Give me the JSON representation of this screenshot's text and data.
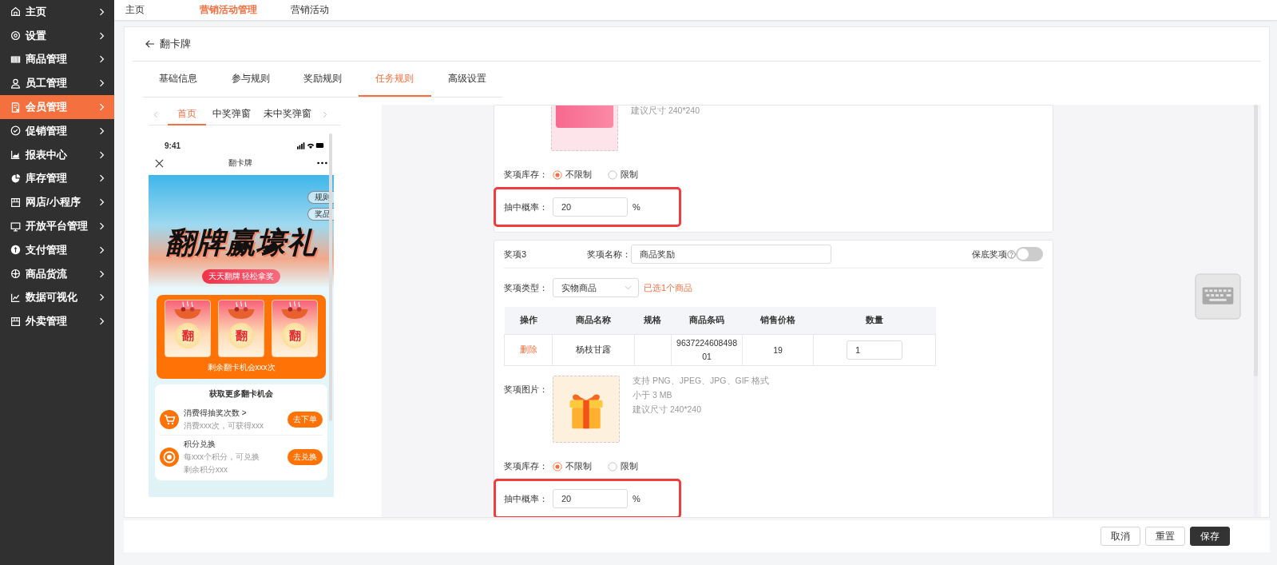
{
  "sidebar": {
    "items": [
      {
        "label": "主页",
        "selected": false
      },
      {
        "label": "设置",
        "selected": false
      },
      {
        "label": "商品管理",
        "selected": false
      },
      {
        "label": "员工管理",
        "selected": false
      },
      {
        "label": "会员管理",
        "selected": true
      },
      {
        "label": "促销管理",
        "selected": false
      },
      {
        "label": "报表中心",
        "selected": false
      },
      {
        "label": "库存管理",
        "selected": false
      },
      {
        "label": "网店/小程序",
        "selected": false
      },
      {
        "label": "开放平台管理",
        "selected": false
      },
      {
        "label": "支付管理",
        "selected": false
      },
      {
        "label": "商品货流",
        "selected": false
      },
      {
        "label": "数据可视化",
        "selected": false
      },
      {
        "label": "外卖管理",
        "selected": false
      }
    ]
  },
  "breadcrumb": [
    {
      "label": "主页",
      "selected": false
    },
    {
      "label": "营销活动管理",
      "selected": true
    },
    {
      "label": "营销活动",
      "selected": false
    }
  ],
  "page": {
    "title": "翻卡牌"
  },
  "tabs": [
    {
      "label": "基础信息",
      "selected": false
    },
    {
      "label": "参与规则",
      "selected": false
    },
    {
      "label": "奖励规则",
      "selected": false
    },
    {
      "label": "任务规则",
      "selected": true
    },
    {
      "label": "高级设置",
      "selected": false
    }
  ],
  "preview": {
    "tabs": [
      {
        "label": "首页",
        "selected": true
      },
      {
        "label": "中奖弹窗",
        "selected": false
      },
      {
        "label": "未中奖弹窗",
        "selected": false
      }
    ],
    "phone": {
      "time": "9:41",
      "title": "翻卡牌",
      "side_buttons": [
        "规则",
        "奖品"
      ],
      "banner_title": "翻牌赢壕礼",
      "banner_tag": "天天翻牌 轻松拿奖",
      "cards": [
        "翻",
        "翻",
        "翻"
      ],
      "remaining": "剩余翻卡机会xxx次",
      "tasks_title": "获取更多翻卡机会",
      "tasks": [
        {
          "title": "消费得抽奖次数 >",
          "lines": [
            "消费xxx次，可获得xxx"
          ],
          "button": "去下单"
        },
        {
          "title": "积分兑换",
          "lines": [
            "每xxx个积分，可兑换",
            "剩余积分xxx"
          ],
          "button": "去兑换"
        }
      ]
    }
  },
  "prizes": [
    {
      "image": {
        "kind": "coupon"
      },
      "image_hints": [
        "建议尺寸 240*240"
      ],
      "stock_label": "奖项库存：",
      "stock_options": [
        {
          "label": "不限制",
          "selected": true
        },
        {
          "label": "限制",
          "selected": false
        }
      ],
      "rate_label": "抽中概率：",
      "rate_value": "20",
      "rate_unit": "%",
      "highlighted": true
    },
    {
      "index_label": "奖项3",
      "name_label": "奖项名称：",
      "name_value": "商品奖励",
      "guarantee_label": "保底奖项",
      "guarantee_on": false,
      "type_label": "奖项类型：",
      "type_value": "实物商品",
      "selected_note": "已选1个商品",
      "table": {
        "columns": [
          {
            "label": "操作",
            "kind": "link"
          },
          {
            "label": "商品名称",
            "kind": "text"
          },
          {
            "label": "规格",
            "kind": "text"
          },
          {
            "label": "商品条码",
            "kind": "wrap"
          },
          {
            "label": "销售价格",
            "kind": "text"
          },
          {
            "label": "数量",
            "kind": "input"
          }
        ],
        "rows": [
          {
            "cells": [
              "删除",
              "杨枝甘露",
              null,
              "963722460849801",
              "19",
              "1"
            ]
          }
        ]
      },
      "image_label": "奖项图片：",
      "image": {
        "kind": "gift"
      },
      "image_hints": [
        "支持 PNG、JPEG、JPG、GIF 格式",
        "小于 3 MB",
        "建议尺寸 240*240"
      ],
      "stock_label": "奖项库存：",
      "stock_options": [
        {
          "label": "不限制",
          "selected": true
        },
        {
          "label": "限制",
          "selected": false
        }
      ],
      "rate_label": "抽中概率：",
      "rate_value": "20",
      "rate_unit": "%",
      "highlighted": true
    }
  ],
  "footer_buttons": [
    {
      "label": "取消",
      "kind": "default"
    },
    {
      "label": "重置",
      "kind": "default"
    },
    {
      "label": "保存",
      "kind": "primary"
    }
  ]
}
